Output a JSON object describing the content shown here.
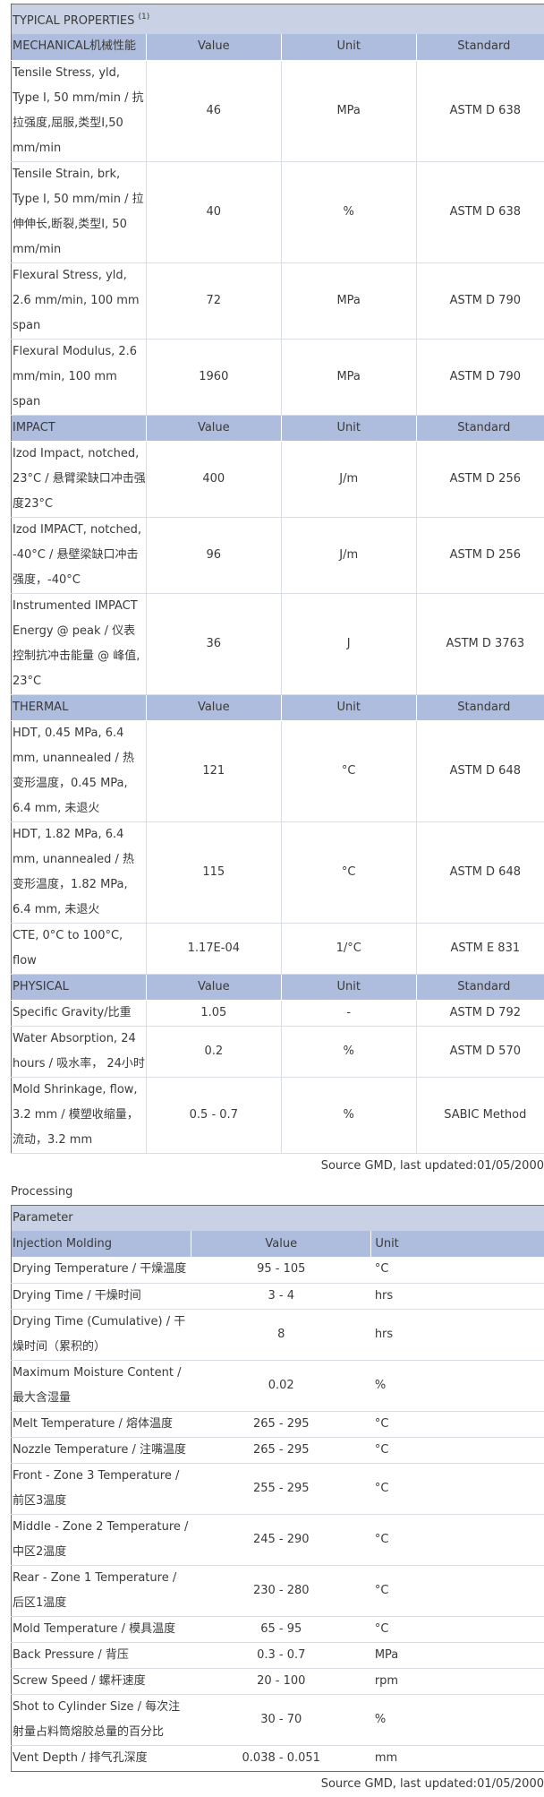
{
  "properties": {
    "title": "TYPICAL PROPERTIES",
    "title_note": "(1)",
    "sections": [
      {
        "header": [
          "MECHANICAL机械性能",
          "Value",
          "Unit",
          "Standard"
        ],
        "rows": [
          {
            "name": "Tensile Stress, yld, Type I, 50 mm/min / 抗拉强度,屈服,类型I,50 mm/min",
            "value": "46",
            "unit": "MPa",
            "standard": "ASTM D 638"
          },
          {
            "name": "Tensile Strain, brk, Type I, 50 mm/min / 拉伸伸长,断裂,类型I, 50 mm/min",
            "value": "40",
            "unit": "%",
            "standard": "ASTM D 638"
          },
          {
            "name": "Flexural Stress, yld, 2.6 mm/min, 100 mm span",
            "value": "72",
            "unit": "MPa",
            "standard": "ASTM D 790"
          },
          {
            "name": "Flexural Modulus, 2.6 mm/min, 100 mm span",
            "value": "1960",
            "unit": "MPa",
            "standard": "ASTM D 790"
          }
        ]
      },
      {
        "header": [
          "IMPACT",
          "Value",
          "Unit",
          "Standard"
        ],
        "rows": [
          {
            "name": "Izod Impact, notched, 23°C / 悬臂梁缺口冲击强度23°C",
            "value": "400",
            "unit": "J/m",
            "standard": "ASTM D 256"
          },
          {
            "name": "Izod IMPACT, notched, -40°C / 悬壁梁缺口冲击强度，-40°C",
            "value": "96",
            "unit": "J/m",
            "standard": "ASTM D 256"
          },
          {
            "name": "Instrumented IMPACT Energy @ peak / 仪表控制抗冲击能量 @ 峰值, 23°C",
            "value": "36",
            "unit": "J",
            "standard": "ASTM D 3763"
          }
        ]
      },
      {
        "header": [
          "THERMAL",
          "Value",
          "Unit",
          "Standard"
        ],
        "rows": [
          {
            "name": "HDT, 0.45 MPa, 6.4 mm, unannealed / 热变形温度，0.45 MPa, 6.4 mm, 未退火",
            "value": "121",
            "unit": "°C",
            "standard": "ASTM D 648"
          },
          {
            "name": "HDT, 1.82 MPa, 6.4 mm, unannealed / 热变形温度，1.82 MPa, 6.4 mm, 未退火",
            "value": "115",
            "unit": "°C",
            "standard": "ASTM D 648"
          },
          {
            "name": "CTE, 0°C to 100°C, flow",
            "value": "1.17E-04",
            "unit": "1/°C",
            "standard": "ASTM E 831"
          }
        ]
      },
      {
        "header": [
          "PHYSICAL",
          "Value",
          "Unit",
          "Standard"
        ],
        "rows": [
          {
            "name": "Specific Gravity/比重",
            "value": "1.05",
            "unit": "-",
            "standard": "ASTM D 792"
          },
          {
            "name": "Water Absorption, 24 hours / 吸水率， 24小时",
            "value": "0.2",
            "unit": "%",
            "standard": "ASTM D 570"
          },
          {
            "name": "Mold Shrinkage, flow, 3.2 mm / 模塑收缩量，流动，3.2 mm",
            "value": "0.5 - 0.7",
            "unit": "%",
            "standard": "SABIC Method"
          }
        ]
      }
    ],
    "source": "Source GMD, last updated:01/05/2000"
  },
  "processing": {
    "title": "Processing",
    "table_title": "Parameter",
    "header": [
      "Injection Molding",
      "Value",
      "Unit"
    ],
    "rows": [
      {
        "name": "Drying Temperature / 干燥温度",
        "value": "95 - 105",
        "unit": "°C"
      },
      {
        "name": "Drying Time / 干燥时间",
        "value": "3 - 4",
        "unit": "hrs"
      },
      {
        "name": "Drying Time (Cumulative) / 干燥时间（累积的）",
        "value": "8",
        "unit": "hrs"
      },
      {
        "name": "Maximum Moisture Content / 最大含湿量",
        "value": "0.02",
        "unit": "%"
      },
      {
        "name": "Melt Temperature / 熔体温度",
        "value": "265 - 295",
        "unit": "°C"
      },
      {
        "name": "Nozzle Temperature / 注嘴温度",
        "value": "265 - 295",
        "unit": "°C"
      },
      {
        "name": "Front - Zone 3 Temperature / 前区3温度",
        "value": "255 - 295",
        "unit": "°C"
      },
      {
        "name": "Middle - Zone 2 Temperature / 中区2温度",
        "value": "245 - 290",
        "unit": "°C"
      },
      {
        "name": "Rear - Zone 1 Temperature / 后区1温度",
        "value": "230 - 280",
        "unit": "°C"
      },
      {
        "name": "Mold Temperature / 模具温度",
        "value": "65 - 95",
        "unit": "°C"
      },
      {
        "name": "Back Pressure / 背压",
        "value": "0.3 - 0.7",
        "unit": "MPa"
      },
      {
        "name": "Screw Speed / 螺杆速度",
        "value": "20 - 100",
        "unit": "rpm"
      },
      {
        "name": "Shot to Cylinder Size / 每次注射量占料筒熔胶总量的百分比",
        "value": "30 - 70",
        "unit": "%"
      },
      {
        "name": "Vent Depth / 排气孔深度",
        "value": "0.038 - 0.051",
        "unit": "mm"
      }
    ],
    "source": "Source GMD, last updated:01/05/2000"
  }
}
